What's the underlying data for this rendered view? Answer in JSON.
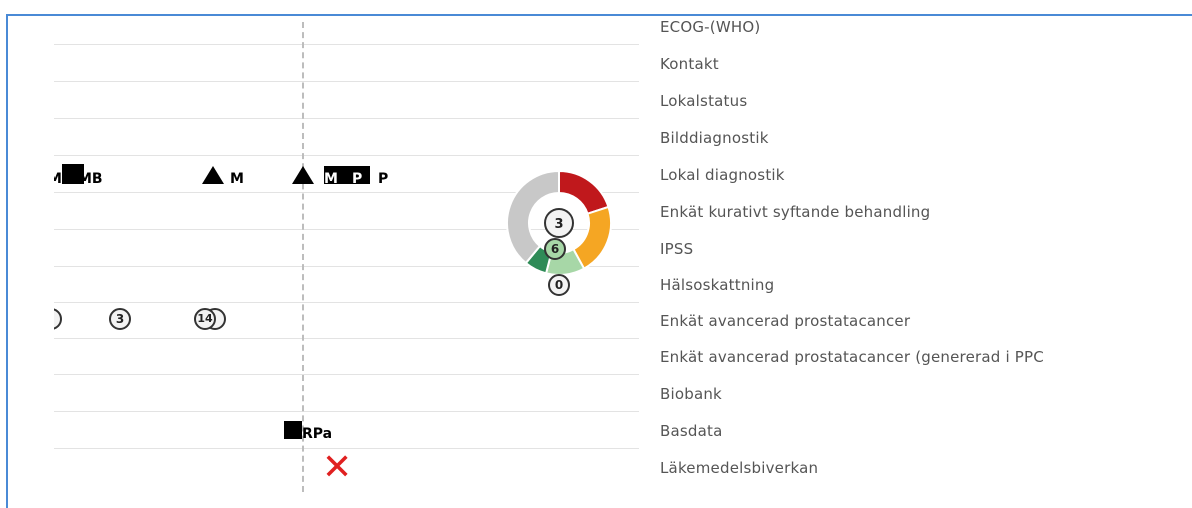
{
  "rows": [
    {
      "label": "ECOG-(WHO)"
    },
    {
      "label": "Kontakt"
    },
    {
      "label": "Lokalstatus"
    },
    {
      "label": "Bilddiagnostik"
    },
    {
      "label": "Lokal diagnostik"
    },
    {
      "label": "Enkät kurativt syftande behandling"
    },
    {
      "label": "IPSS"
    },
    {
      "label": "Hälsoskattning"
    },
    {
      "label": "Enkät avancerad prostatacancer"
    },
    {
      "label": "Enkät avancerad prostatacancer (genererad i PPC"
    },
    {
      "label": "Biobank"
    },
    {
      "label": "Basdata"
    },
    {
      "label": "Läkemedelsbiverkan"
    }
  ],
  "markers": {
    "lokal_a_text": "M",
    "lokal_a_text2": "MB",
    "lokal_b_text": "M",
    "lokal_c_text": "M",
    "lokal_c_text2": "P",
    "lokal_c_text3": "P",
    "donut_center": "3",
    "ipss_value": "6",
    "halso_value": "0",
    "avanc_values": [
      "3",
      "14"
    ],
    "basdata_text": "RPa",
    "lakemedel_symbol": "✕"
  },
  "donut": {
    "segments": [
      {
        "value": 0.2,
        "color": "#c0181c"
      },
      {
        "value": 0.22,
        "color": "#f5a623"
      },
      {
        "value": 0.12,
        "color": "#a7d7a7"
      },
      {
        "value": 0.07,
        "color": "#2e8b57"
      },
      {
        "value": 0.39,
        "color": "#c8c8c8"
      }
    ]
  },
  "colors": {
    "frame": "#4a8ad6",
    "cross": "#e02020"
  }
}
